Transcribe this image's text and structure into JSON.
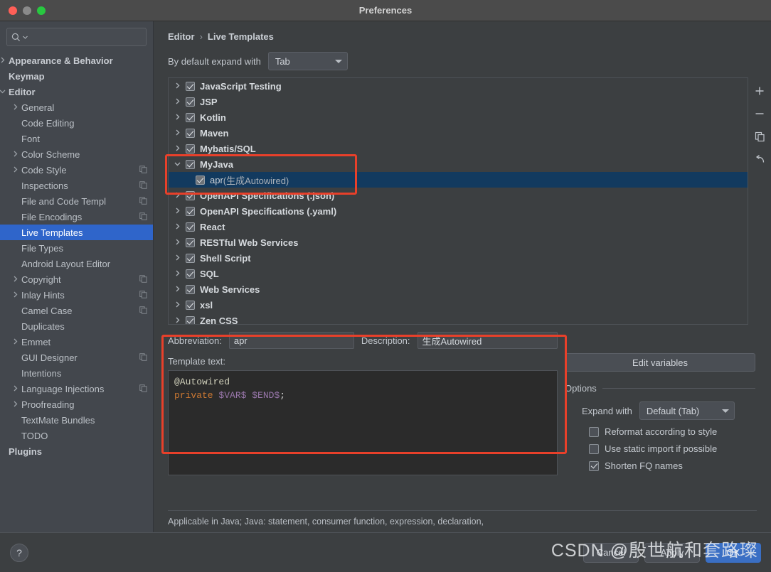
{
  "window": {
    "title": "Preferences",
    "traffic": [
      "close",
      "minimize",
      "zoom"
    ]
  },
  "sidebar": {
    "search_placeholder": "",
    "search_value": "",
    "items": [
      {
        "label": "Appearance & Behavior",
        "level": 0,
        "arrow": "right",
        "bold": true,
        "badge": false,
        "selected": false
      },
      {
        "label": "Keymap",
        "level": 0,
        "arrow": "none",
        "bold": true,
        "badge": false,
        "selected": false
      },
      {
        "label": "Editor",
        "level": 0,
        "arrow": "down",
        "bold": true,
        "badge": false,
        "selected": false
      },
      {
        "label": "General",
        "level": 1,
        "arrow": "right",
        "bold": false,
        "badge": false,
        "selected": false
      },
      {
        "label": "Code Editing",
        "level": 1,
        "arrow": "none",
        "bold": false,
        "badge": false,
        "selected": false
      },
      {
        "label": "Font",
        "level": 1,
        "arrow": "none",
        "bold": false,
        "badge": false,
        "selected": false
      },
      {
        "label": "Color Scheme",
        "level": 1,
        "arrow": "right",
        "bold": false,
        "badge": false,
        "selected": false
      },
      {
        "label": "Code Style",
        "level": 1,
        "arrow": "right",
        "bold": false,
        "badge": true,
        "selected": false
      },
      {
        "label": "Inspections",
        "level": 1,
        "arrow": "none",
        "bold": false,
        "badge": true,
        "selected": false
      },
      {
        "label": "File and Code Templ",
        "level": 1,
        "arrow": "none",
        "bold": false,
        "badge": true,
        "selected": false
      },
      {
        "label": "File Encodings",
        "level": 1,
        "arrow": "none",
        "bold": false,
        "badge": true,
        "selected": false
      },
      {
        "label": "Live Templates",
        "level": 1,
        "arrow": "none",
        "bold": false,
        "badge": false,
        "selected": true
      },
      {
        "label": "File Types",
        "level": 1,
        "arrow": "none",
        "bold": false,
        "badge": false,
        "selected": false
      },
      {
        "label": "Android Layout Editor",
        "level": 1,
        "arrow": "none",
        "bold": false,
        "badge": false,
        "selected": false
      },
      {
        "label": "Copyright",
        "level": 1,
        "arrow": "right",
        "bold": false,
        "badge": true,
        "selected": false
      },
      {
        "label": "Inlay Hints",
        "level": 1,
        "arrow": "right",
        "bold": false,
        "badge": true,
        "selected": false
      },
      {
        "label": "Camel Case",
        "level": 1,
        "arrow": "none",
        "bold": false,
        "badge": true,
        "selected": false
      },
      {
        "label": "Duplicates",
        "level": 1,
        "arrow": "none",
        "bold": false,
        "badge": false,
        "selected": false
      },
      {
        "label": "Emmet",
        "level": 1,
        "arrow": "right",
        "bold": false,
        "badge": false,
        "selected": false
      },
      {
        "label": "GUI Designer",
        "level": 1,
        "arrow": "none",
        "bold": false,
        "badge": true,
        "selected": false
      },
      {
        "label": "Intentions",
        "level": 1,
        "arrow": "none",
        "bold": false,
        "badge": false,
        "selected": false
      },
      {
        "label": "Language Injections",
        "level": 1,
        "arrow": "right",
        "bold": false,
        "badge": true,
        "selected": false
      },
      {
        "label": "Proofreading",
        "level": 1,
        "arrow": "right",
        "bold": false,
        "badge": false,
        "selected": false
      },
      {
        "label": "TextMate Bundles",
        "level": 1,
        "arrow": "none",
        "bold": false,
        "badge": false,
        "selected": false
      },
      {
        "label": "TODO",
        "level": 1,
        "arrow": "none",
        "bold": false,
        "badge": false,
        "selected": false
      },
      {
        "label": "Plugins",
        "level": 0,
        "arrow": "none",
        "bold": true,
        "badge": false,
        "selected": false
      }
    ]
  },
  "breadcrumb": {
    "root": "Editor",
    "separator": "›",
    "current": "Live Templates"
  },
  "expand": {
    "label": "By default expand with",
    "value": "Tab"
  },
  "templates": [
    {
      "label": "JavaScript Testing",
      "level": 0,
      "arrow": "right",
      "checked": true,
      "selected": false,
      "desc": ""
    },
    {
      "label": "JSP",
      "level": 0,
      "arrow": "right",
      "checked": true,
      "selected": false,
      "desc": ""
    },
    {
      "label": "Kotlin",
      "level": 0,
      "arrow": "right",
      "checked": true,
      "selected": false,
      "desc": ""
    },
    {
      "label": "Maven",
      "level": 0,
      "arrow": "right",
      "checked": true,
      "selected": false,
      "desc": ""
    },
    {
      "label": "Mybatis/SQL",
      "level": 0,
      "arrow": "right",
      "checked": true,
      "selected": false,
      "desc": ""
    },
    {
      "label": "MyJava",
      "level": 0,
      "arrow": "down",
      "checked": true,
      "selected": false,
      "desc": ""
    },
    {
      "label": "apr",
      "level": 1,
      "arrow": "none",
      "checked": true,
      "selected": true,
      "desc": "(生成Autowired)"
    },
    {
      "label": "OpenAPI Specifications (.json)",
      "level": 0,
      "arrow": "right",
      "checked": true,
      "selected": false,
      "desc": ""
    },
    {
      "label": "OpenAPI Specifications (.yaml)",
      "level": 0,
      "arrow": "right",
      "checked": true,
      "selected": false,
      "desc": ""
    },
    {
      "label": "React",
      "level": 0,
      "arrow": "right",
      "checked": true,
      "selected": false,
      "desc": ""
    },
    {
      "label": "RESTful Web Services",
      "level": 0,
      "arrow": "right",
      "checked": true,
      "selected": false,
      "desc": ""
    },
    {
      "label": "Shell Script",
      "level": 0,
      "arrow": "right",
      "checked": true,
      "selected": false,
      "desc": ""
    },
    {
      "label": "SQL",
      "level": 0,
      "arrow": "right",
      "checked": true,
      "selected": false,
      "desc": ""
    },
    {
      "label": "Web Services",
      "level": 0,
      "arrow": "right",
      "checked": true,
      "selected": false,
      "desc": ""
    },
    {
      "label": "xsl",
      "level": 0,
      "arrow": "right",
      "checked": true,
      "selected": false,
      "desc": ""
    },
    {
      "label": "Zen CSS",
      "level": 0,
      "arrow": "right",
      "checked": true,
      "selected": false,
      "desc": ""
    }
  ],
  "toolbar": {
    "add": "add-icon",
    "remove": "remove-icon",
    "copy": "copy-icon",
    "revert": "revert-icon"
  },
  "detail": {
    "abbreviation_label": "Abbreviation:",
    "abbreviation_value": "apr",
    "description_label": "Description:",
    "description_value": "生成Autowired",
    "template_text_label": "Template text:",
    "code_line1": "@Autowired",
    "code_kw": "private",
    "code_var1": "$VAR$",
    "code_var2": "$END$",
    "code_semi": ";",
    "edit_variables_label": "Edit variables",
    "options_label": "Options",
    "expand_with_label": "Expand with",
    "expand_with_value": "Default (Tab)",
    "checkboxes": [
      {
        "label": "Reformat according to style",
        "checked": false
      },
      {
        "label": "Use static import if possible",
        "checked": false
      },
      {
        "label": "Shorten FQ names",
        "checked": true
      }
    ]
  },
  "applicable": "Applicable in Java; Java: statement, consumer function, expression, declaration,",
  "footer": {
    "help_label": "?",
    "cancel_label": "Cancel",
    "apply_label": "Apply",
    "ok_label": "OK"
  },
  "watermark": "CSDN @殷世航和套路璨",
  "colors": {
    "accent_selection": "#2f65ca",
    "list_selection": "#123a5f",
    "annotation_red": "#e8402a",
    "primary_button": "#3a6fc4",
    "code_keyword": "#cc7832",
    "code_variable": "#9876aa",
    "code_annotation": "#d0d0bb"
  }
}
